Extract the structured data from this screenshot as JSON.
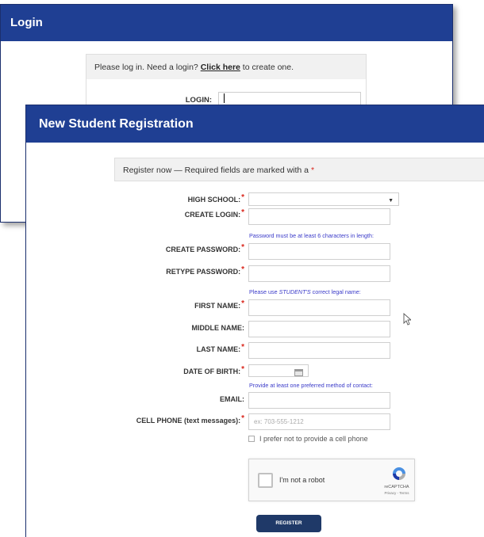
{
  "login": {
    "title": "Login",
    "notice_prefix": "Please log in. Need a login? ",
    "notice_link": "Click here",
    "notice_suffix": " to create one.",
    "login_label": "LOGIN:"
  },
  "registration": {
    "title": "New Student Registration",
    "header_text": "Register now — Required fields are marked with a ",
    "required_mark": "*",
    "hints": {
      "password": "Password must be at least 6 characters in length:",
      "legal_prefix": "Please use ",
      "legal_emphasis": "STUDENT'S",
      "legal_suffix": " correct legal name:",
      "contact": "Provide at least one preferred method of contact:"
    },
    "fields": {
      "high_school": "HIGH SCHOOL:",
      "create_login": "CREATE LOGIN:",
      "create_password": "CREATE PASSWORD:",
      "retype_password": "RETYPE PASSWORD:",
      "first_name": "FIRST NAME:",
      "middle_name": "MIDDLE NAME:",
      "last_name": "LAST NAME:",
      "date_of_birth": "DATE OF BIRTH:",
      "email": "EMAIL:",
      "cell_phone": "CELL PHONE (text messages):"
    },
    "cell_phone_placeholder": "ex: 703-555-1212",
    "no_cell_checkbox": "I prefer not to provide a cell phone",
    "captcha": {
      "label": "I'm not a robot",
      "brand": "reCAPTCHA",
      "links": "Privacy - Terms"
    },
    "register_button": "REGISTER"
  },
  "colors": {
    "title_bar": "#1f3f93",
    "required": "#d9261c",
    "hint": "#3a3ac9",
    "button": "#1f3968"
  }
}
